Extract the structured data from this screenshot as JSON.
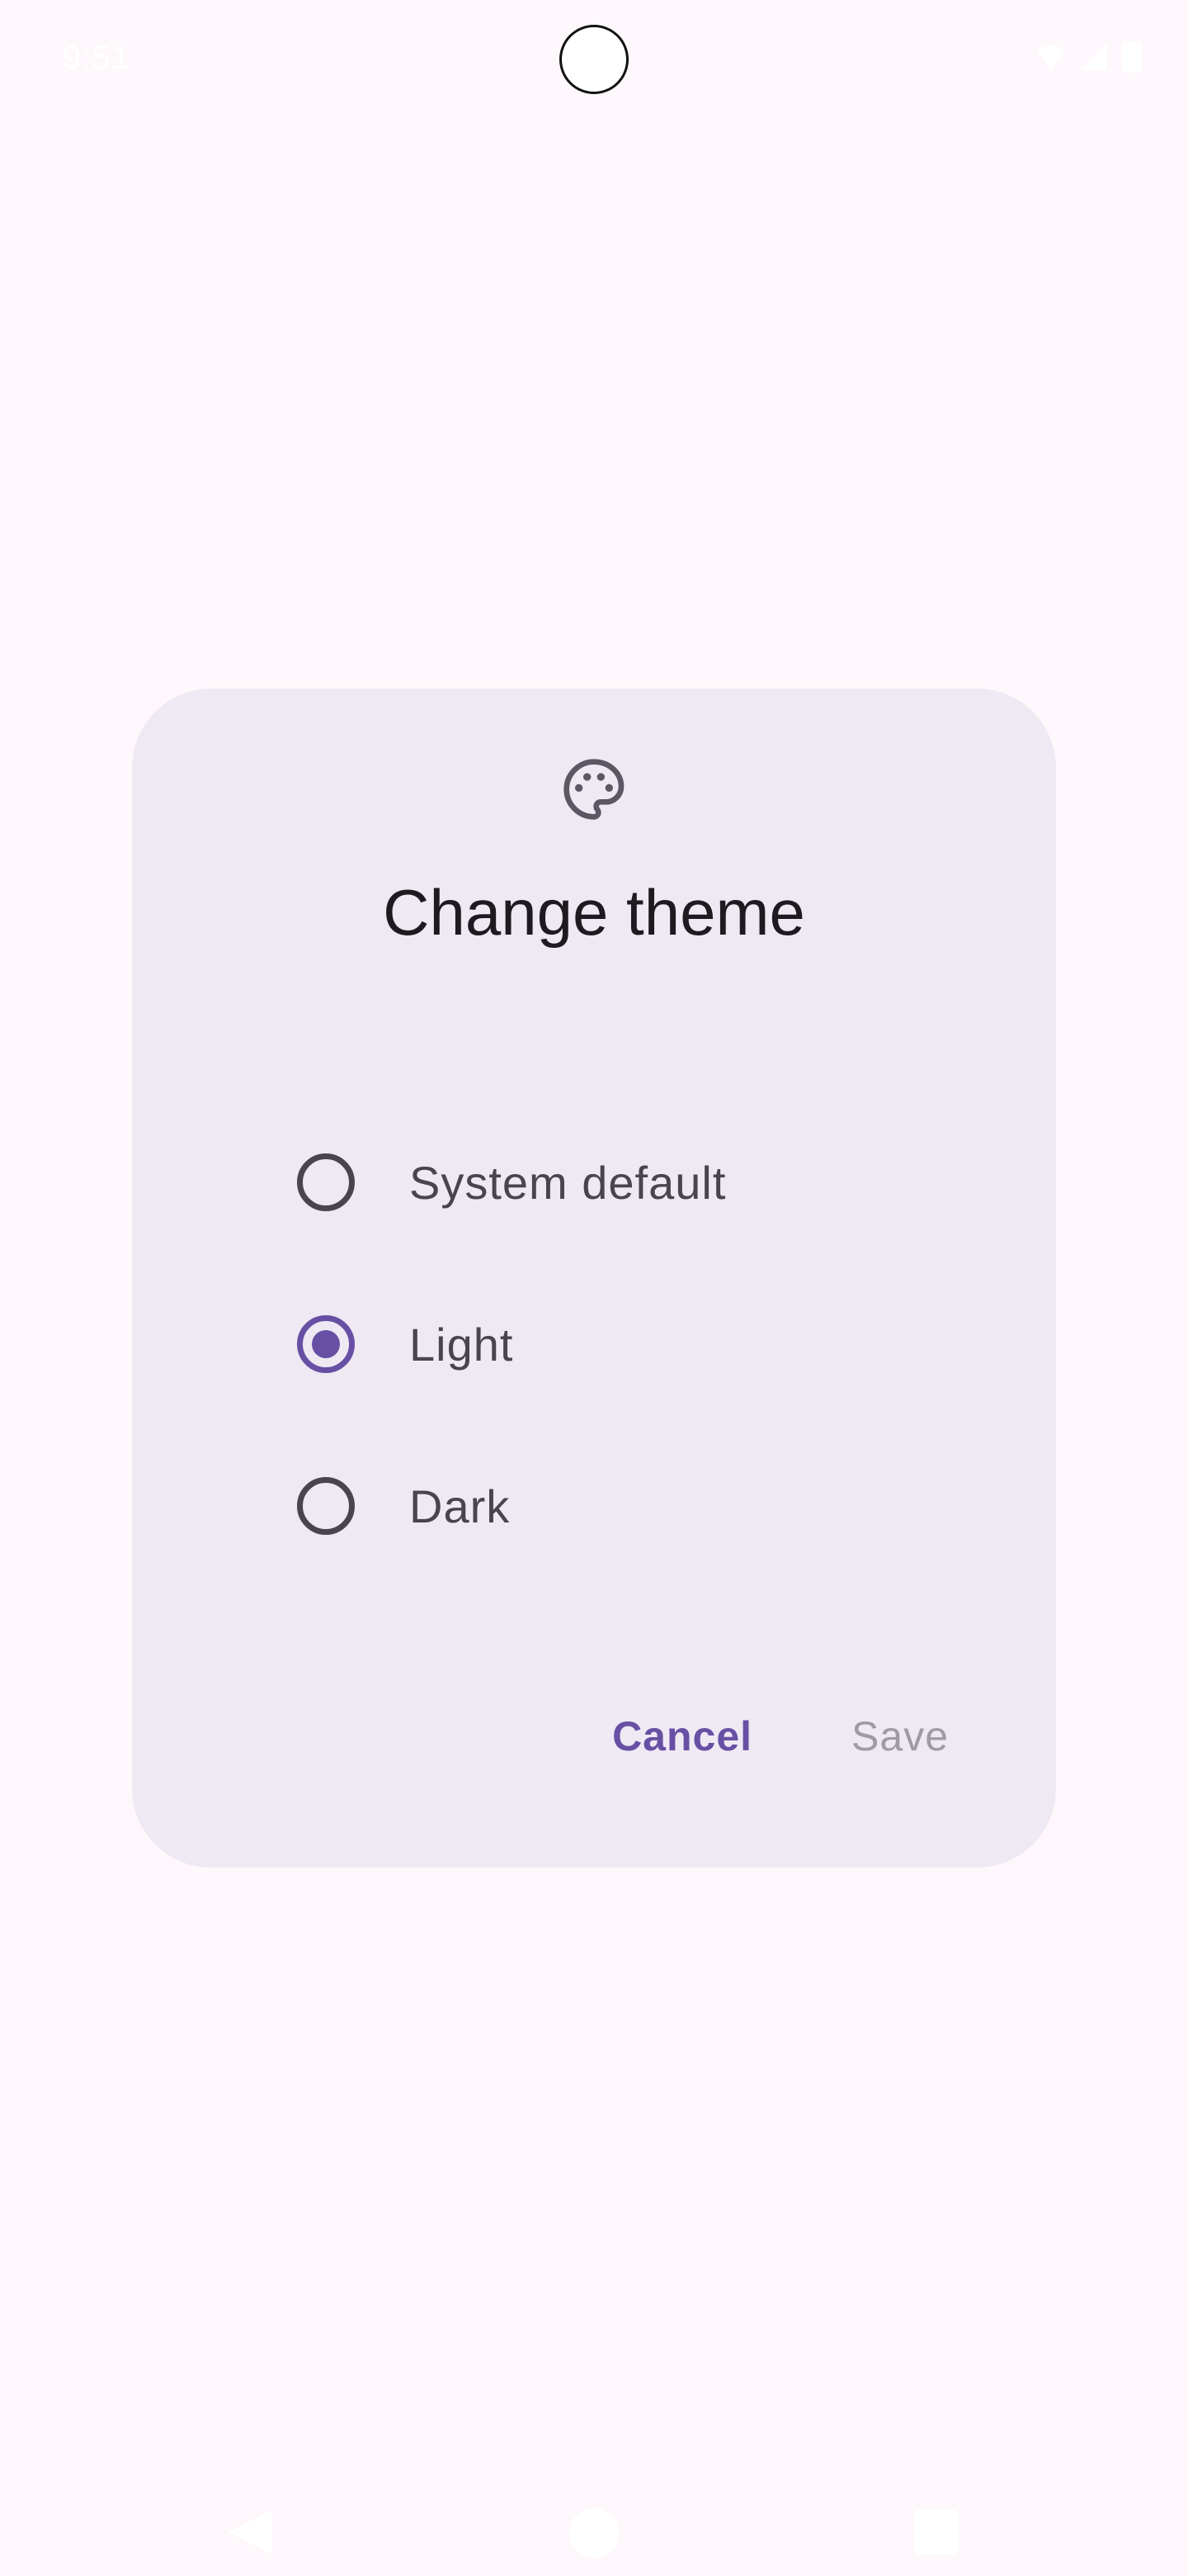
{
  "status_bar": {
    "time": "9:51",
    "icons": [
      "wifi-icon",
      "signal-icon",
      "battery-icon"
    ]
  },
  "dialog": {
    "icon": "palette-icon",
    "title": "Change theme",
    "options": [
      {
        "label": "System default",
        "selected": false
      },
      {
        "label": "Light",
        "selected": true
      },
      {
        "label": "Dark",
        "selected": false
      }
    ],
    "cancel_label": "Cancel",
    "save_label": "Save",
    "save_enabled": false
  },
  "nav_bar": {
    "icons": [
      "back-icon",
      "home-icon",
      "recents-icon"
    ]
  },
  "colors": {
    "background": "#FEF7FB",
    "dialog_surface": "#EEE9F3",
    "primary": "#6750A4",
    "on_surface": "#1D1B20",
    "on_surface_variant": "#49454F",
    "disabled": "#A09AA6"
  }
}
